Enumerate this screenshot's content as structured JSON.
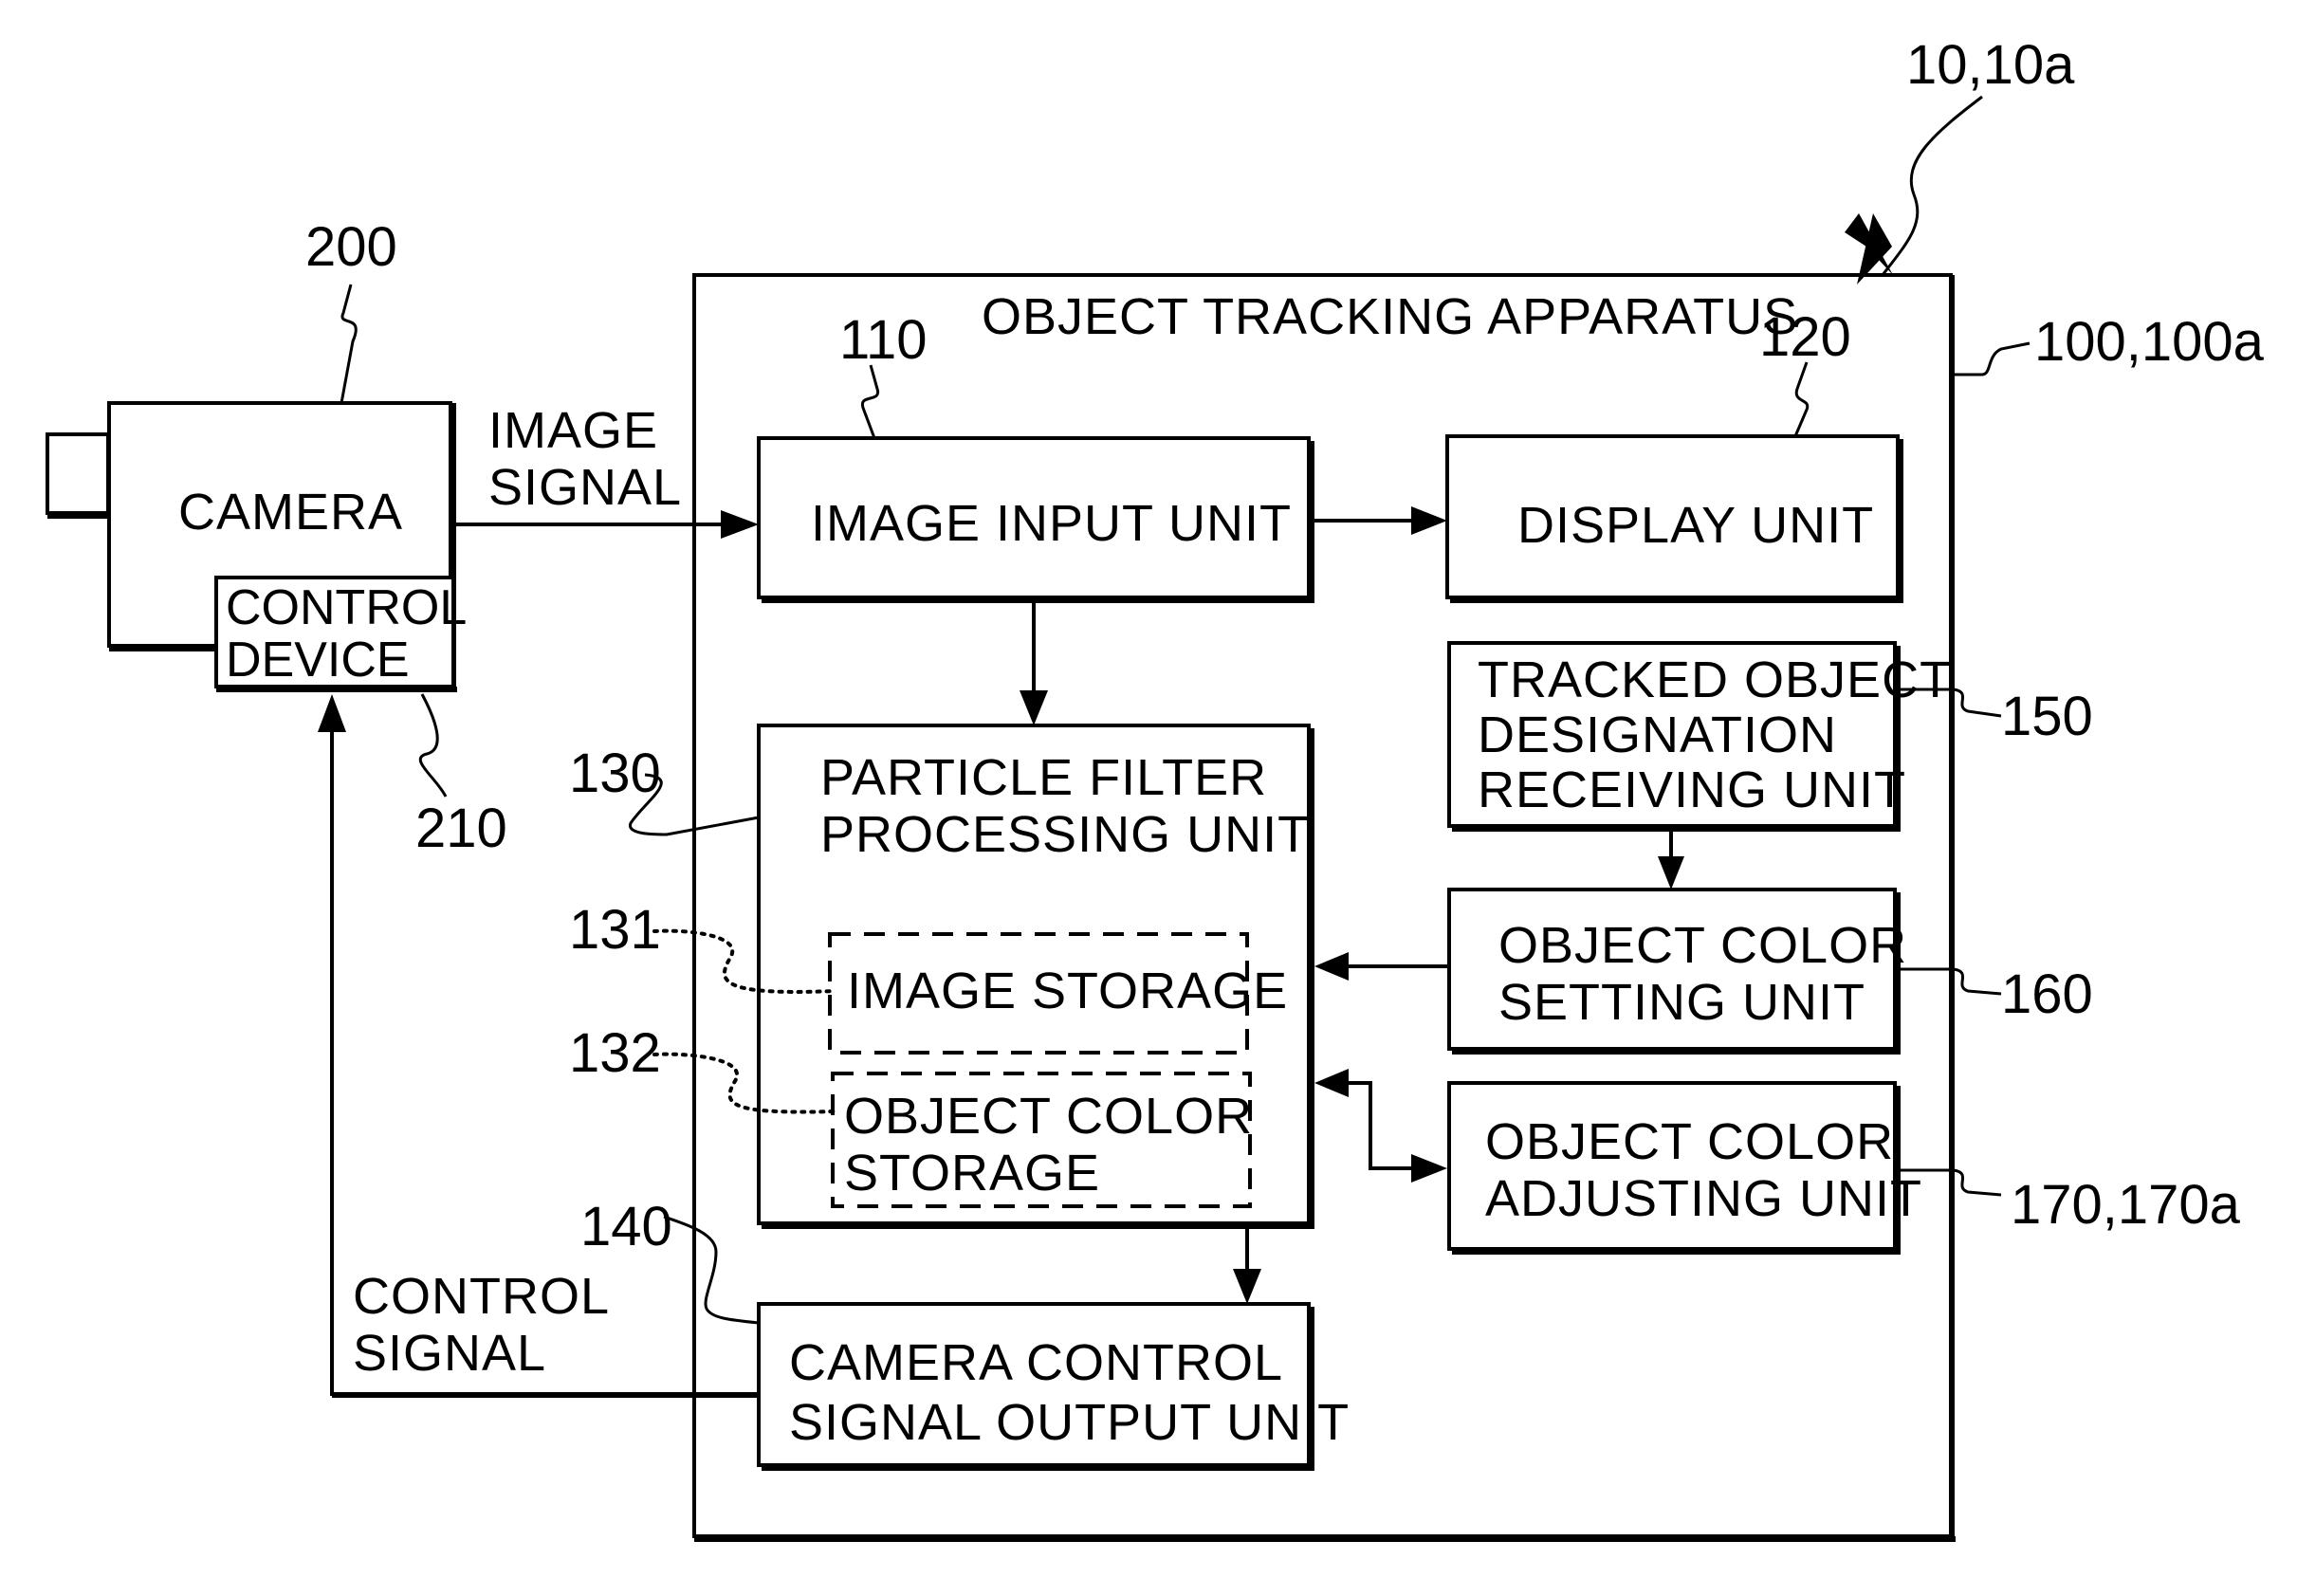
{
  "figure": {
    "system_ref": "10,10a",
    "camera": {
      "ref": "200",
      "label": "CAMERA",
      "control_device": {
        "ref": "210",
        "label_line1": "CONTROL",
        "label_line2": "DEVICE"
      }
    },
    "signals": {
      "image_signal_line1": "IMAGE",
      "image_signal_line2": "SIGNAL",
      "control_signal_line1": "CONTROL",
      "control_signal_line2": "SIGNAL"
    },
    "apparatus": {
      "ref": "100,100a",
      "title": "OBJECT TRACKING APPARATUS",
      "units": {
        "image_input": {
          "ref": "110",
          "label": "IMAGE INPUT UNIT"
        },
        "display": {
          "ref": "120",
          "label": "DISPLAY UNIT"
        },
        "particle_filter": {
          "ref": "130",
          "label_line1": "PARTICLE FILTER",
          "label_line2": "PROCESSING UNIT",
          "image_storage": {
            "ref": "131",
            "label": "IMAGE STORAGE"
          },
          "object_color_storage": {
            "ref": "132",
            "label_line1": "OBJECT COLOR",
            "label_line2": "STORAGE"
          }
        },
        "camera_control_output": {
          "ref": "140",
          "label_line1": "CAMERA CONTROL",
          "label_line2": "SIGNAL OUTPUT UNIT"
        },
        "tracked_object_designation": {
          "ref": "150",
          "label_line1": "TRACKED OBJECT",
          "label_line2": "DESIGNATION",
          "label_line3": "RECEIVING UNIT"
        },
        "object_color_setting": {
          "ref": "160",
          "label_line1": "OBJECT COLOR",
          "label_line2": "SETTING UNIT"
        },
        "object_color_adjusting": {
          "ref": "170,170a",
          "label_line1": "OBJECT COLOR",
          "label_line2": "ADJUSTING UNIT"
        }
      }
    }
  }
}
